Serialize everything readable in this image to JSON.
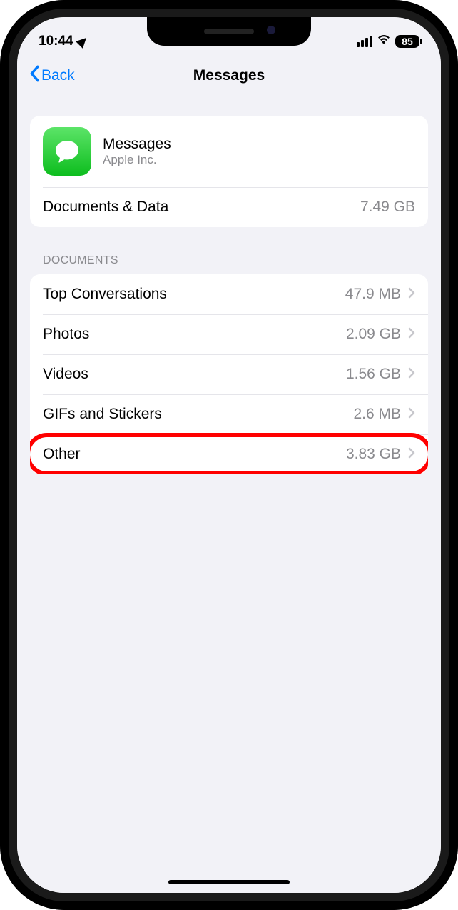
{
  "status": {
    "time": "10:44",
    "battery": "85"
  },
  "nav": {
    "back_label": "Back",
    "title": "Messages"
  },
  "app": {
    "name": "Messages",
    "vendor": "Apple Inc."
  },
  "storage": {
    "docs_data_label": "Documents & Data",
    "docs_data_value": "7.49 GB"
  },
  "documents": {
    "header": "DOCUMENTS",
    "items": [
      {
        "label": "Top Conversations",
        "value": "47.9 MB"
      },
      {
        "label": "Photos",
        "value": "2.09 GB"
      },
      {
        "label": "Videos",
        "value": "1.56 GB"
      },
      {
        "label": "GIFs and Stickers",
        "value": "2.6 MB"
      },
      {
        "label": "Other",
        "value": "3.83 GB"
      }
    ]
  }
}
